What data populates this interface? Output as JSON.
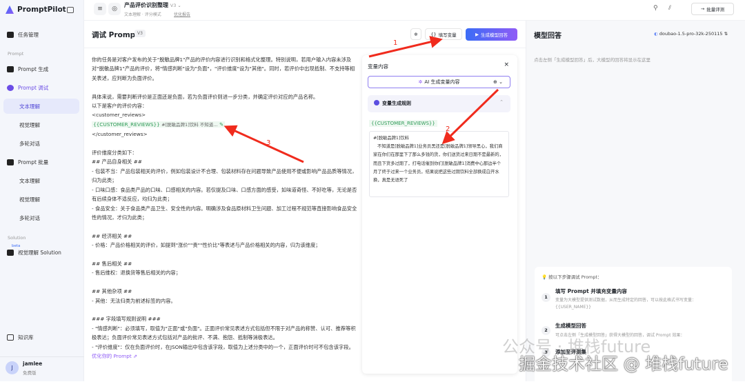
{
  "app": {
    "name": "PromptPilot"
  },
  "sidebar": {
    "task_mgmt": "任务管理",
    "section_prompt": "Prompt",
    "prompt_gen": "Prompt 生成",
    "prompt_debug": "Prompt 调试",
    "debug_items": [
      "文本理解",
      "视觉理解",
      "多轮对话"
    ],
    "prompt_batch": "Prompt 批量",
    "batch_items": [
      "文本理解",
      "视觉理解",
      "多轮对话"
    ],
    "section_solution": "Solution",
    "beta": "beta",
    "vision_solution": "视觉理解 Solution",
    "knowledge": "知识库",
    "user": {
      "initial": "J",
      "name": "jamlee",
      "plan": "免费版"
    }
  },
  "header": {
    "title": "产品评价识别整理",
    "version": "V3",
    "subtitle": "文本理解 · 评分模式",
    "report": "优化报告",
    "batch_eval": "批量评测"
  },
  "main": {
    "title": "调试 Prompt",
    "version": "V3",
    "fill_vars": "填写变量",
    "generate": "生成模型回答",
    "paragraphs": [
      "你的任务是对客户发布的关于\"脱敏品牌1\"产品的评价内容进行识别和格式化整理。特别说明，若用户输入内容未涉及对\"脱敏品牌1\"产品的评价，将\"情感判断\"设为\"负面\"，\"评价维度\"设为\"其他\"。同时，若评价中出现抵制、不支持等相关表述，应判断为负面评价。\n\n具体来说，需要判断评价是正面还是负面，若为负面评价则进一步分类，并确定评价对应的产品名称。\n以下是客户的评价内容：\n<customer_reviews>"
    ],
    "var_name": "{{CUSTOMER_REVIEWS}}",
    "var_preview": "#[脱敏品牌1]饮料 不知道...",
    "after": "</customer_reviews>\n\n评价维度分类如下：\n## 产品自身相关 ##\n- 包装不当：产品包装相关的评价，例如包装设计不合理、包装材料存在问题导致产品使用不便或影响产品品质等情况，归为此类；\n- 口味口感：食品类产品的口味、口感相关的内容。若仅提及口味、口感方面的感受，如味道奇怪、不好吃等，无论是否有后续身体不适反应，均归为此类；\n- 食品安全：关于食品类产品卫生、安全性的内容。明确涉及食品原材料卫生问题、加工过程不规范等直接影响食品安全性的情况，才归为此类；\n\n## 经济相关 ##\n- 价格：产品价格相关的评价，如提到\"涨价\"\"贵\"\"性价比\"等表述与产品价格相关的内容，归为该维度；\n\n## 售后相关 ##\n- 售后维权：退换货等售后相关的内容；\n\n## 其他杂项 ##\n- 其他：无法归类为前述标签的内容。\n\n### 字段填写规则说明 ###\n- \"情感判断\"：必须填写，取值为\"正面\"或\"负面\"。正面评价常见表述方式包括但不限于对产品的称赞、认可、推荐等积极表达；负面评价常见表述方式包括对产品的批评、不满、抱怨、抵制等消极表达。\n- \"评价维度\"：仅在负面评价时，在JSON输出中包含该字段，取值为上述分类中的一个，正面评价时可不包含该字段。",
    "optimize": "优化你的 Prompt ⇗"
  },
  "var_panel": {
    "title": "变量内容",
    "ai_gen": "AI 生成变量内容",
    "rules": "变量生成规则",
    "var_name": "{{CUSTOMER_REVIEWS}}",
    "value": "#[脱敏品牌1]饮料\n   不知道是[脱敏品牌1]业务员黑还是[脱敏品牌1]领导黑心，我们商家在你们在那里下了那么多钱的货，你们送货过来日期不是最新的，而且下货多过期了，打电话催到你们[脱敏品牌1]消费中心那边半个月了终于过来一个业务员，结果说把这些过期饮料全部换成白开水换，真是无语死了"
  },
  "right": {
    "title": "模型回答",
    "model": "doubao-1.5-pro-32k-250115",
    "placeholder": "点击左侧「生成模型回答」后，大模型的回答将显示在这里",
    "guide_title": "按以下步骤调试 Prompt：",
    "steps": [
      {
        "n": "1",
        "title": "填写 Prompt 并填充变量内容",
        "desc": "变量为大模型提供测试数据，从而生成特定的回答，可以按此格式书写变量：{{USER_NAME}}"
      },
      {
        "n": "2",
        "title": "生成模型回答",
        "desc": "可点击左侧「生成模型回答」获得大模型的回答，调试 Prompt 效果："
      },
      {
        "n": "3",
        "title": "添加至评测集",
        "desc": ""
      }
    ]
  },
  "annotations": [
    "1",
    "2",
    "3"
  ],
  "watermark": [
    "公众号 · 堆栈future",
    "掘金技术社区 @ 堆栈future"
  ],
  "colors": {
    "accent": "#6b4de6",
    "primary_btn": "#3b6cf6",
    "arrow": "#f02b1d",
    "var_green": "#2f9b57"
  }
}
